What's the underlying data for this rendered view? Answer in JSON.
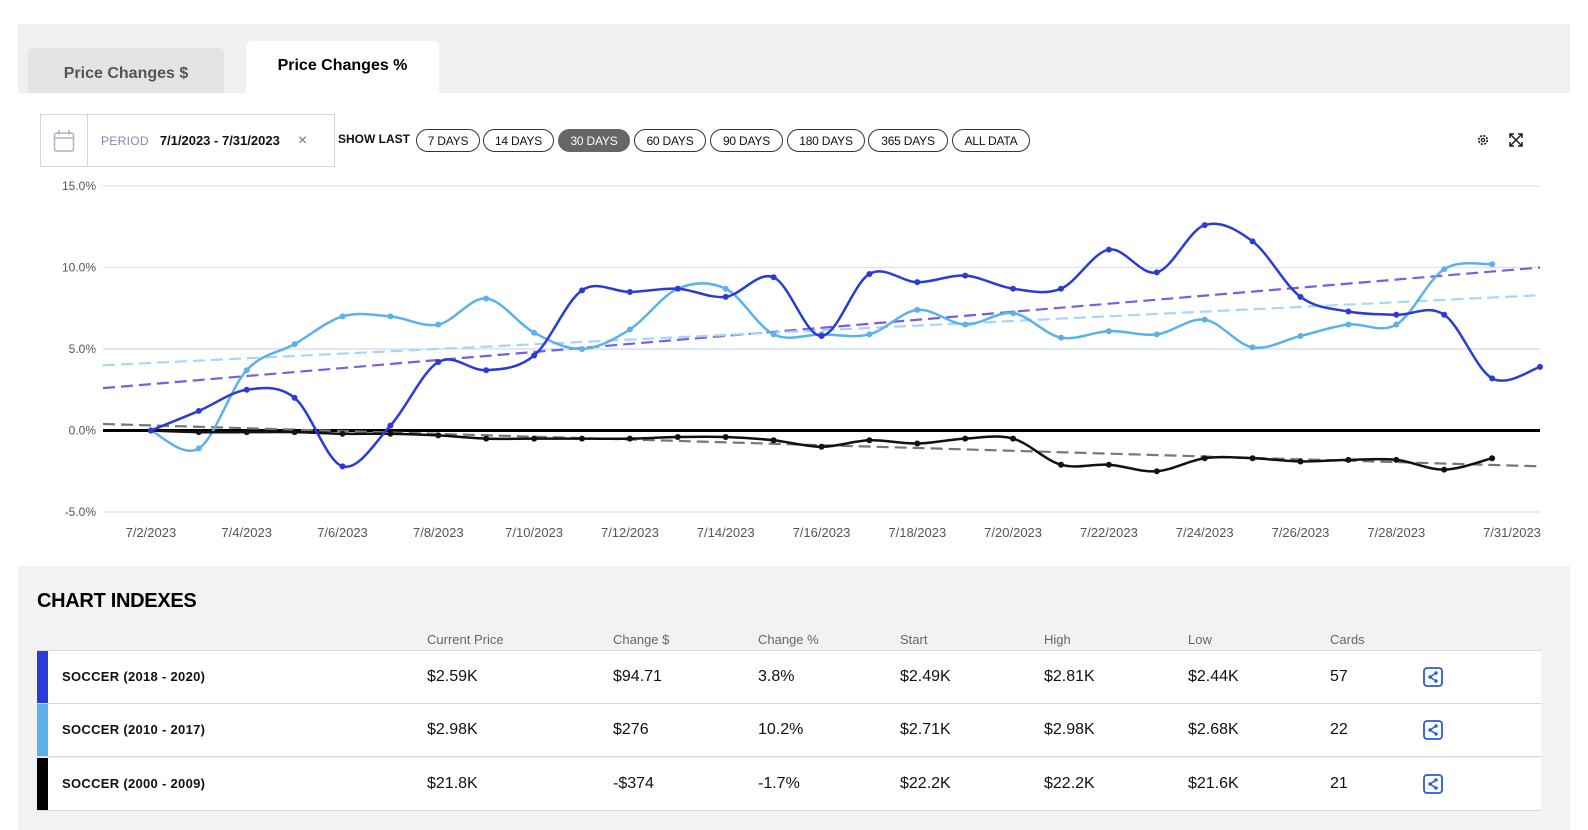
{
  "tabs": [
    {
      "label": "Price Changes $",
      "active": false
    },
    {
      "label": "Price Changes %",
      "active": true
    }
  ],
  "period": {
    "label": "PERIOD",
    "value": "7/1/2023 - 7/31/2023",
    "clear_icon": "close-icon",
    "calendar_icon": "calendar-icon"
  },
  "show_last": {
    "label": "SHOW LAST",
    "options": [
      "7 DAYS",
      "14 DAYS",
      "30 DAYS",
      "60 DAYS",
      "90 DAYS",
      "180 DAYS",
      "365 DAYS",
      "ALL DATA"
    ],
    "selected": "30 DAYS"
  },
  "toolbar": {
    "settings_icon": "gear-icon",
    "expand_icon": "expand-icon"
  },
  "chart_data": {
    "type": "line",
    "x_tick_labels": [
      "7/2/2023",
      "7/4/2023",
      "7/6/2023",
      "7/8/2023",
      "7/10/2023",
      "7/12/2023",
      "7/14/2023",
      "7/16/2023",
      "7/18/2023",
      "7/20/2023",
      "7/22/2023",
      "7/24/2023",
      "7/26/2023",
      "7/28/2023",
      "7/31/2023"
    ],
    "y_tick_labels": [
      "15.0%",
      "10.0%",
      "5.0%",
      "0.0%",
      "-5.0%"
    ],
    "ylim": [
      -5,
      15
    ],
    "x_range_days": [
      1,
      31
    ],
    "series": [
      {
        "color": "#2b3bd6",
        "x": [
          2,
          3,
          4,
          5,
          6,
          7,
          8,
          9,
          10,
          11,
          12,
          13,
          14,
          15,
          16,
          17,
          18,
          19,
          20,
          21,
          22,
          23,
          24,
          25,
          26,
          27,
          28,
          29,
          30,
          31
        ],
        "values": [
          0.0,
          1.2,
          2.5,
          2.0,
          -2.2,
          0.3,
          4.2,
          3.7,
          4.6,
          8.6,
          8.5,
          8.7,
          8.2,
          9.4,
          5.8,
          9.6,
          9.1,
          9.5,
          8.7,
          8.7,
          11.1,
          9.7,
          12.6,
          11.6,
          8.2,
          7.3,
          7.1,
          7.1,
          3.2,
          3.9
        ],
        "trend": [
          2.6,
          10.0
        ],
        "trend_color": "#7b5ce6"
      },
      {
        "color": "#5bb2ea",
        "x": [
          2,
          3,
          4,
          5,
          6,
          7,
          8,
          9,
          10,
          11,
          12,
          13,
          14,
          15,
          16,
          17,
          18,
          19,
          20,
          21,
          22,
          23,
          24,
          25,
          26,
          27,
          28,
          29,
          30
        ],
        "values": [
          0.0,
          -1.1,
          3.7,
          5.3,
          7.0,
          7.0,
          6.5,
          8.1,
          6.0,
          5.0,
          6.2,
          8.7,
          8.7,
          5.9,
          5.9,
          5.9,
          7.4,
          6.5,
          7.2,
          5.7,
          6.1,
          5.9,
          6.8,
          5.1,
          5.8,
          6.5,
          6.5,
          9.9,
          10.2
        ],
        "trend": [
          4.0,
          8.3
        ],
        "trend_color": "#a8d4f5"
      },
      {
        "color": "#111111",
        "x": [
          2,
          3,
          4,
          5,
          6,
          7,
          8,
          9,
          10,
          11,
          12,
          13,
          14,
          15,
          16,
          17,
          18,
          19,
          20,
          21,
          22,
          23,
          24,
          25,
          26,
          27,
          28,
          29,
          30
        ],
        "values": [
          0.0,
          -0.1,
          -0.1,
          -0.1,
          -0.2,
          -0.2,
          -0.3,
          -0.5,
          -0.5,
          -0.5,
          -0.5,
          -0.4,
          -0.4,
          -0.6,
          -1.0,
          -0.6,
          -0.8,
          -0.5,
          -0.5,
          -2.1,
          -2.1,
          -2.5,
          -1.7,
          -1.7,
          -1.9,
          -1.8,
          -1.8,
          -2.4,
          -1.7
        ],
        "trend": [
          0.4,
          -2.2
        ],
        "trend_color": "#777777"
      }
    ],
    "baseline": 0
  },
  "indexes": {
    "title": "CHART INDEXES",
    "columns": [
      "Current Price",
      "Change $",
      "Change %",
      "Start",
      "High",
      "Low",
      "Cards"
    ],
    "rows": [
      {
        "color": "#2b3bd6",
        "name": "SOCCER (2018 - 2020)",
        "values": [
          "$2.59K",
          "$94.71",
          "3.8%",
          "$2.49K",
          "$2.81K",
          "$2.44K",
          "57"
        ]
      },
      {
        "color": "#5bb2ea",
        "name": "SOCCER (2010 - 2017)",
        "values": [
          "$2.98K",
          "$276",
          "10.2%",
          "$2.71K",
          "$2.98K",
          "$2.68K",
          "22"
        ]
      },
      {
        "color": "#000000",
        "name": "SOCCER (2000 - 2009)",
        "values": [
          "$21.8K",
          "-$374",
          "-1.7%",
          "$22.2K",
          "$22.2K",
          "$21.6K",
          "21"
        ]
      }
    ],
    "share_icon": "share-icon"
  }
}
